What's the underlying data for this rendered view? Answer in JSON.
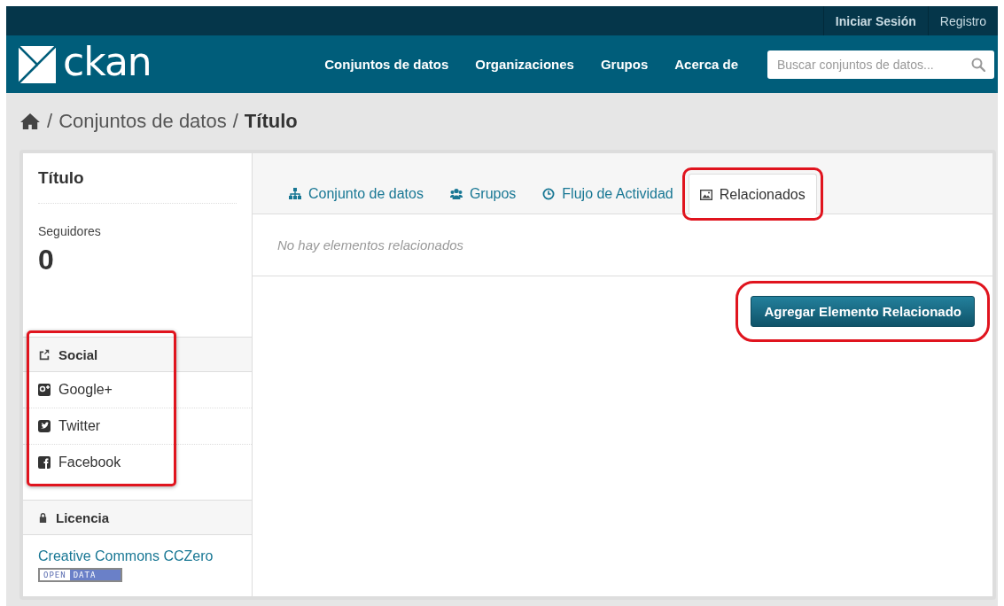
{
  "account_links": [
    {
      "label": "Iniciar Sesión",
      "bold": true
    },
    {
      "label": "Registro",
      "bold": false
    }
  ],
  "logo": {
    "text": "ckan"
  },
  "nav": [
    "Conjuntos de datos",
    "Organizaciones",
    "Grupos",
    "Acerca de"
  ],
  "search": {
    "placeholder": "Buscar conjuntos de datos..."
  },
  "breadcrumb_separator": "/",
  "breadcrumb": [
    {
      "label": "Conjuntos de datos",
      "current": false
    },
    {
      "label": "Título",
      "current": true
    }
  ],
  "sidebar": {
    "title": "Título",
    "followers_label": "Seguidores",
    "followers_count": "0",
    "social": {
      "heading": "Social",
      "highlighted": true,
      "items": [
        {
          "kind": "google",
          "label": "Google+"
        },
        {
          "kind": "twitter",
          "label": "Twitter"
        },
        {
          "kind": "facebook",
          "label": "Facebook"
        }
      ]
    },
    "license": {
      "heading": "Licencia",
      "link": "Creative Commons CCZero",
      "badge": [
        "OPEN",
        "DATA"
      ]
    }
  },
  "tabs": [
    {
      "kind": "dataset",
      "label": "Conjunto de datos",
      "selected": false,
      "highlighted": false
    },
    {
      "kind": "groups",
      "label": "Grupos",
      "selected": false,
      "highlighted": false
    },
    {
      "kind": "activity",
      "label": "Flujo de Actividad",
      "selected": false,
      "highlighted": false
    },
    {
      "kind": "related",
      "label": "Relacionados",
      "selected": true,
      "highlighted": true
    }
  ],
  "empty_message": "No hay elementos relacionados",
  "add_button": {
    "label": "Agregar Elemento Relacionado",
    "highlighted": true
  }
}
